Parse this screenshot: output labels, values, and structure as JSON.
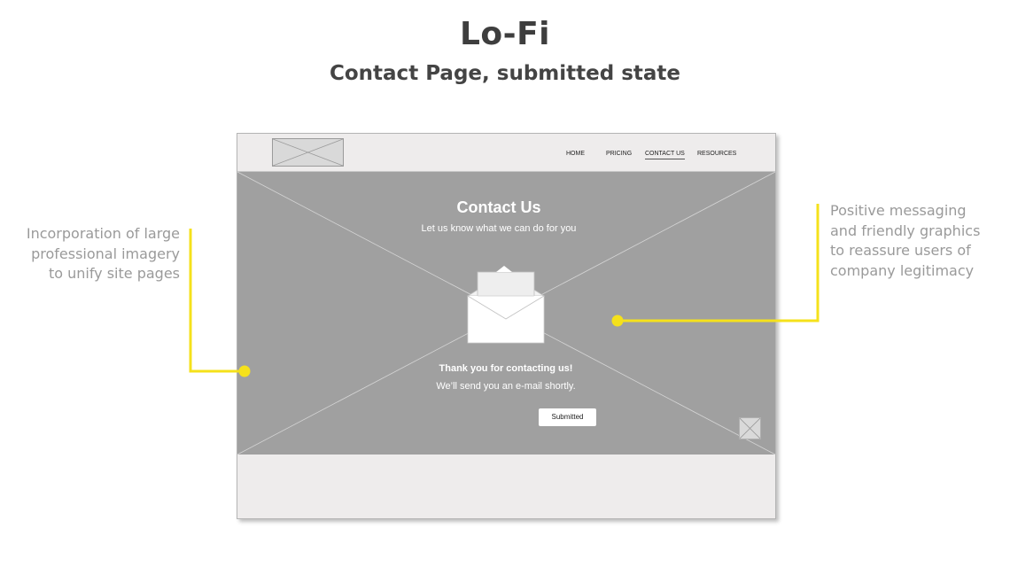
{
  "header": {
    "title": "Lo-Fi",
    "subtitle": "Contact Page, submitted state"
  },
  "wireframe": {
    "nav": {
      "items": [
        {
          "label": "HOME",
          "active": false
        },
        {
          "label": "PRICING",
          "active": false
        },
        {
          "label": "CONTACT US",
          "active": true
        },
        {
          "label": "RESOURCES",
          "active": false
        }
      ]
    },
    "hero": {
      "title": "Contact Us",
      "subtitle": "Let us know what we can do for you",
      "icon": "envelope-icon",
      "thanks_title": "Thank you for contacting us!",
      "thanks_body": "We’ll send you an e-mail shortly.",
      "button_label": "Submitted"
    }
  },
  "annotations": {
    "left_lines": [
      "Incorporation of  large",
      "professional imagery",
      "to unify site pages"
    ],
    "right_lines": [
      "Positive messaging",
      "and friendly graphics",
      "to reassure users of",
      "company legitimacy"
    ]
  },
  "colors": {
    "accent": "#f5e11b",
    "hero_bg": "#a0a0a0",
    "frame_bg": "#eeecec",
    "annotation_text": "#9a9a9a",
    "title_text": "#3e3e3e"
  }
}
